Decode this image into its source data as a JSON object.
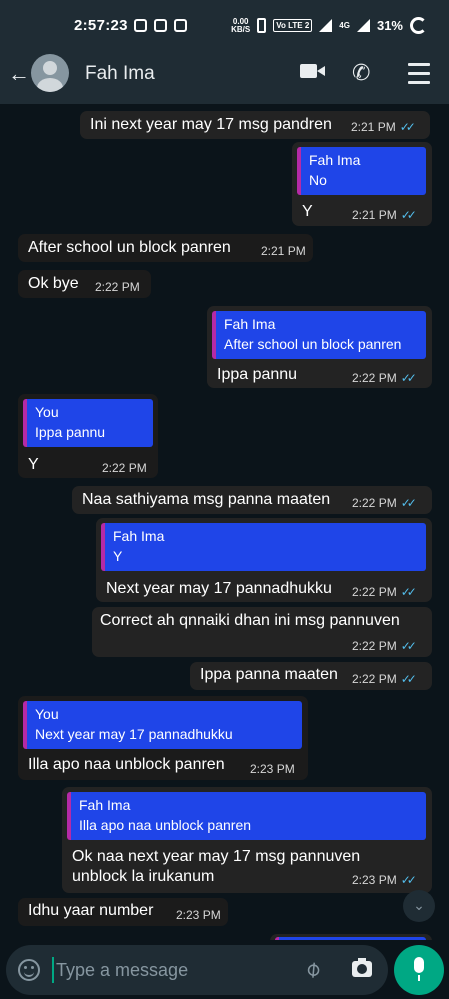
{
  "status_bar": {
    "time": "2:57:23",
    "speed": "0.00",
    "speed_unit": "KB/S",
    "volte": "Vo LTE 2",
    "network": "4G",
    "battery": "31%"
  },
  "header": {
    "contact_name": "Fah Ima"
  },
  "messages": [
    {
      "dir": "out",
      "text": "Ini next year may 17 msg pandren",
      "time": "2:21 PM",
      "read": true
    },
    {
      "dir": "out",
      "quote_author": "Fah Ima",
      "quote_text": "No",
      "text": "Y",
      "time": "2:21 PM",
      "read": true
    },
    {
      "dir": "in",
      "text": "After school un block panren",
      "time": "2:21 PM"
    },
    {
      "dir": "in",
      "text": "Ok bye",
      "time": "2:22 PM"
    },
    {
      "dir": "out",
      "quote_author": "Fah Ima",
      "quote_text": "After school un block panren",
      "text": "Ippa pannu",
      "time": "2:22 PM",
      "read": true
    },
    {
      "dir": "in",
      "quote_author": "You",
      "quote_text": "Ippa pannu",
      "text": "Y",
      "time": "2:22 PM"
    },
    {
      "dir": "out",
      "text": "Naa sathiyama msg panna maaten",
      "time": "2:22 PM",
      "read": true
    },
    {
      "dir": "out",
      "quote_author": "Fah Ima",
      "quote_text": "Y",
      "text": "Next year may 17 pannadhukku",
      "time": "2:22 PM",
      "read": true
    },
    {
      "dir": "out",
      "text": "Correct ah qnnaiki dhan ini msg pannuven",
      "time": "2:22 PM",
      "read": true
    },
    {
      "dir": "out",
      "text": "Ippa panna maaten",
      "time": "2:22 PM",
      "read": true
    },
    {
      "dir": "in",
      "quote_author": "You",
      "quote_text": "Next year may 17 pannadhukku",
      "text": "Illa apo naa unblock panren",
      "time": "2:23 PM"
    },
    {
      "dir": "out",
      "quote_author": "Fah Ima",
      "quote_text": "Illa apo naa unblock panren",
      "text_line1": "Ok naa next year may 17 msg pannuven",
      "text_line2": "unblock la irukanum",
      "time": "2:23 PM",
      "read": true
    },
    {
      "dir": "in",
      "text": "Idhu yaar number",
      "time": "2:23 PM"
    }
  ],
  "composer": {
    "placeholder": "Type a message"
  },
  "colors": {
    "background": "#0b141a",
    "header": "#1f2c34",
    "quote": "#1f45e8",
    "quote_bar": "#b52aa6",
    "read_ticks": "#53bdeb",
    "accent": "#00a884"
  }
}
